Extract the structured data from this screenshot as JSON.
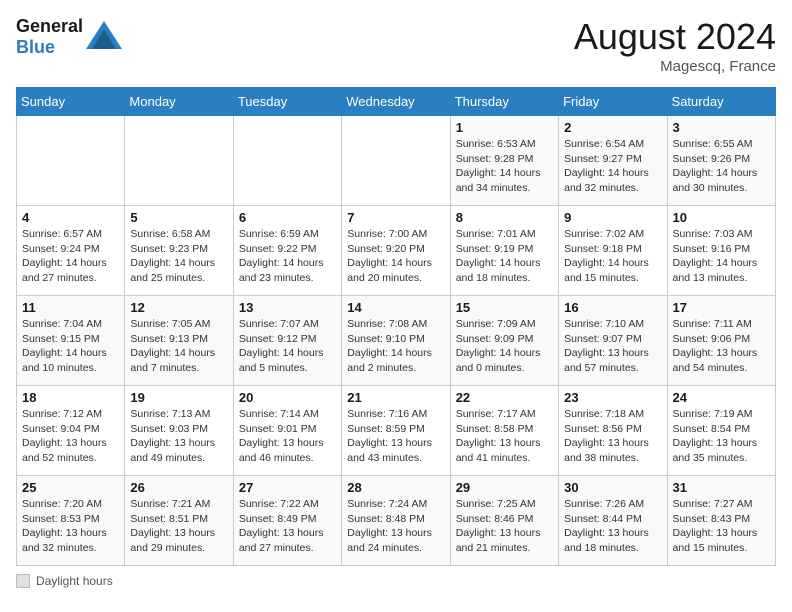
{
  "header": {
    "logo_line1": "General",
    "logo_line2": "Blue",
    "month_year": "August 2024",
    "location": "Magescq, France"
  },
  "weekdays": [
    "Sunday",
    "Monday",
    "Tuesday",
    "Wednesday",
    "Thursday",
    "Friday",
    "Saturday"
  ],
  "legend": {
    "label": "Daylight hours"
  },
  "weeks": [
    [
      {
        "day": "",
        "content": ""
      },
      {
        "day": "",
        "content": ""
      },
      {
        "day": "",
        "content": ""
      },
      {
        "day": "",
        "content": ""
      },
      {
        "day": "1",
        "content": "Sunrise: 6:53 AM\nSunset: 9:28 PM\nDaylight: 14 hours\nand 34 minutes."
      },
      {
        "day": "2",
        "content": "Sunrise: 6:54 AM\nSunset: 9:27 PM\nDaylight: 14 hours\nand 32 minutes."
      },
      {
        "day": "3",
        "content": "Sunrise: 6:55 AM\nSunset: 9:26 PM\nDaylight: 14 hours\nand 30 minutes."
      }
    ],
    [
      {
        "day": "4",
        "content": "Sunrise: 6:57 AM\nSunset: 9:24 PM\nDaylight: 14 hours\nand 27 minutes."
      },
      {
        "day": "5",
        "content": "Sunrise: 6:58 AM\nSunset: 9:23 PM\nDaylight: 14 hours\nand 25 minutes."
      },
      {
        "day": "6",
        "content": "Sunrise: 6:59 AM\nSunset: 9:22 PM\nDaylight: 14 hours\nand 23 minutes."
      },
      {
        "day": "7",
        "content": "Sunrise: 7:00 AM\nSunset: 9:20 PM\nDaylight: 14 hours\nand 20 minutes."
      },
      {
        "day": "8",
        "content": "Sunrise: 7:01 AM\nSunset: 9:19 PM\nDaylight: 14 hours\nand 18 minutes."
      },
      {
        "day": "9",
        "content": "Sunrise: 7:02 AM\nSunset: 9:18 PM\nDaylight: 14 hours\nand 15 minutes."
      },
      {
        "day": "10",
        "content": "Sunrise: 7:03 AM\nSunset: 9:16 PM\nDaylight: 14 hours\nand 13 minutes."
      }
    ],
    [
      {
        "day": "11",
        "content": "Sunrise: 7:04 AM\nSunset: 9:15 PM\nDaylight: 14 hours\nand 10 minutes."
      },
      {
        "day": "12",
        "content": "Sunrise: 7:05 AM\nSunset: 9:13 PM\nDaylight: 14 hours\nand 7 minutes."
      },
      {
        "day": "13",
        "content": "Sunrise: 7:07 AM\nSunset: 9:12 PM\nDaylight: 14 hours\nand 5 minutes."
      },
      {
        "day": "14",
        "content": "Sunrise: 7:08 AM\nSunset: 9:10 PM\nDaylight: 14 hours\nand 2 minutes."
      },
      {
        "day": "15",
        "content": "Sunrise: 7:09 AM\nSunset: 9:09 PM\nDaylight: 14 hours\nand 0 minutes."
      },
      {
        "day": "16",
        "content": "Sunrise: 7:10 AM\nSunset: 9:07 PM\nDaylight: 13 hours\nand 57 minutes."
      },
      {
        "day": "17",
        "content": "Sunrise: 7:11 AM\nSunset: 9:06 PM\nDaylight: 13 hours\nand 54 minutes."
      }
    ],
    [
      {
        "day": "18",
        "content": "Sunrise: 7:12 AM\nSunset: 9:04 PM\nDaylight: 13 hours\nand 52 minutes."
      },
      {
        "day": "19",
        "content": "Sunrise: 7:13 AM\nSunset: 9:03 PM\nDaylight: 13 hours\nand 49 minutes."
      },
      {
        "day": "20",
        "content": "Sunrise: 7:14 AM\nSunset: 9:01 PM\nDaylight: 13 hours\nand 46 minutes."
      },
      {
        "day": "21",
        "content": "Sunrise: 7:16 AM\nSunset: 8:59 PM\nDaylight: 13 hours\nand 43 minutes."
      },
      {
        "day": "22",
        "content": "Sunrise: 7:17 AM\nSunset: 8:58 PM\nDaylight: 13 hours\nand 41 minutes."
      },
      {
        "day": "23",
        "content": "Sunrise: 7:18 AM\nSunset: 8:56 PM\nDaylight: 13 hours\nand 38 minutes."
      },
      {
        "day": "24",
        "content": "Sunrise: 7:19 AM\nSunset: 8:54 PM\nDaylight: 13 hours\nand 35 minutes."
      }
    ],
    [
      {
        "day": "25",
        "content": "Sunrise: 7:20 AM\nSunset: 8:53 PM\nDaylight: 13 hours\nand 32 minutes."
      },
      {
        "day": "26",
        "content": "Sunrise: 7:21 AM\nSunset: 8:51 PM\nDaylight: 13 hours\nand 29 minutes."
      },
      {
        "day": "27",
        "content": "Sunrise: 7:22 AM\nSunset: 8:49 PM\nDaylight: 13 hours\nand 27 minutes."
      },
      {
        "day": "28",
        "content": "Sunrise: 7:24 AM\nSunset: 8:48 PM\nDaylight: 13 hours\nand 24 minutes."
      },
      {
        "day": "29",
        "content": "Sunrise: 7:25 AM\nSunset: 8:46 PM\nDaylight: 13 hours\nand 21 minutes."
      },
      {
        "day": "30",
        "content": "Sunrise: 7:26 AM\nSunset: 8:44 PM\nDaylight: 13 hours\nand 18 minutes."
      },
      {
        "day": "31",
        "content": "Sunrise: 7:27 AM\nSunset: 8:43 PM\nDaylight: 13 hours\nand 15 minutes."
      }
    ]
  ]
}
